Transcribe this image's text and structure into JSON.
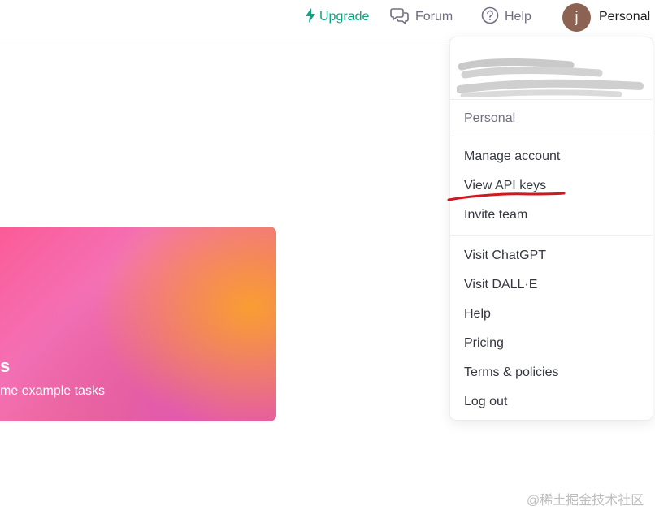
{
  "header": {
    "upgrade_label": "Upgrade",
    "forum_label": "Forum",
    "help_label": "Help",
    "account_label": "Personal",
    "avatar_initial": "j",
    "icons": {
      "upgrade": "lightning-bolt-icon",
      "forum": "chat-bubbles-icon",
      "help": "question-circle-icon"
    }
  },
  "hero": {
    "title_fragment": "s",
    "subtitle": "me example tasks"
  },
  "menu": {
    "org_label": "Personal",
    "items": [
      "Manage account",
      "View API keys",
      "Invite team",
      "Visit ChatGPT",
      "Visit DALL·E",
      "Help",
      "Pricing",
      "Terms & policies",
      "Log out"
    ]
  },
  "watermark": "@稀土掘金技术社区",
  "colors": {
    "accent_green": "#10a37f",
    "avatar_bg": "#8c6253",
    "annotation_red": "#d0181f"
  }
}
